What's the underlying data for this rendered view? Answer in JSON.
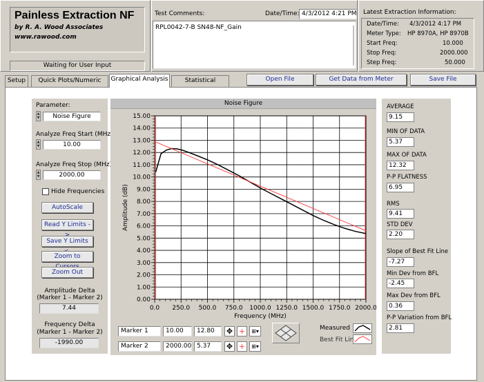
{
  "app": {
    "title": "Painless Extraction NF",
    "byline": "by R. A. Wood Associates",
    "url": "www.rawood.com",
    "status": "Waiting for User Input"
  },
  "test_comments": {
    "label": "Test Comments:",
    "date_time_label": "Date/Time:",
    "date_time_value": "4/3/2012  4:21 PM",
    "text": "RPL0042-7-B SN48-NF_Gain"
  },
  "latest": {
    "title": "Latest Extraction Information:",
    "rows": [
      {
        "label": "Date/Time:",
        "value": "4/3/2012  4:17 PM"
      },
      {
        "label": "Meter Type:",
        "value": "HP 8970A, HP 8970B"
      },
      {
        "label": "Start Freq:",
        "value": "10.000"
      },
      {
        "label": "Stop Freq:",
        "value": "2000.000"
      },
      {
        "label": "Step Freq:",
        "value": "50.000"
      }
    ]
  },
  "tabs": [
    "Setup",
    "Quick Plots/Numeric Data",
    "Graphical Analysis",
    "Statistical Analysis"
  ],
  "toolbar": {
    "open": "Open File",
    "get_data": "Get Data from Meter",
    "save": "Save File"
  },
  "left": {
    "parameter_label": "Parameter:",
    "parameter_value": "Noise Figure",
    "start_label": "Analyze Freq Start (MHz)",
    "start_value": "10.00",
    "stop_label": "Analyze Freq Stop (MHz)",
    "stop_value": "2000.00",
    "hide_label": "Hide Frequencies",
    "autoscale": "AutoScale",
    "read_y": "Read Y Limits ->",
    "save_y": "Save Y Limits <-",
    "zoom_cursors": "Zoom to Cursors",
    "zoom_out": "Zoom Out",
    "amp_delta_label1": "Amplitude Delta",
    "amp_delta_label2": "(Marker 1 - Marker 2)",
    "amp_delta_value": "7.44",
    "freq_delta_label1": "Frequency Delta",
    "freq_delta_label2": "(Marker 1 - Marker 2)",
    "freq_delta_value": "-1990.00"
  },
  "markers": [
    {
      "name": "Marker 1",
      "x": "10.00",
      "y": "12.80"
    },
    {
      "name": "Marker 2",
      "x": "2000.00",
      "y": "5.37"
    }
  ],
  "legend": {
    "measured": "Measured",
    "bestfit": "Best Fit Line"
  },
  "stats": [
    {
      "label": "AVERAGE",
      "value": "9.15"
    },
    {
      "label": "MIN OF DATA",
      "value": "5.37"
    },
    {
      "label": "MAX OF DATA",
      "value": "12.32"
    },
    {
      "label": "P-P FLATNESS",
      "value": "6.95"
    },
    {
      "label": "RMS",
      "value": "9.41"
    },
    {
      "label": "STD DEV",
      "value": "2.20"
    },
    {
      "label": "Slope of Best Fit Line",
      "value": "-7.27"
    },
    {
      "label": "Min Dev from BFL",
      "value": "-2.45"
    },
    {
      "label": "Max Dev from BFL",
      "value": "0.36"
    },
    {
      "label": "P-P Variation from BFL",
      "value": "2.81"
    }
  ],
  "colors": {
    "measured": "#000000",
    "bestfit": "#ff3030",
    "cursor": "#ff4040",
    "button_text": "#1e2d96"
  },
  "chart_data": {
    "type": "line",
    "title": "Noise Figure",
    "xlabel": "Frequency (MHz)",
    "ylabel": "Amplitude (dB)",
    "xlim": [
      0,
      2000
    ],
    "ylim": [
      0,
      15
    ],
    "xticks": [
      "0.0",
      "250.0",
      "500.0",
      "750.0",
      "1000.0",
      "1250.0",
      "1500.0",
      "1750.0",
      "2000.0"
    ],
    "yticks": [
      "0.00",
      "1.00",
      "2.00",
      "3.00",
      "4.00",
      "5.00",
      "6.00",
      "7.00",
      "8.00",
      "9.00",
      "10.00",
      "11.00",
      "12.00",
      "13.00",
      "14.00",
      "15.00"
    ],
    "grid": true,
    "series": [
      {
        "name": "Measured",
        "x": [
          10,
          60,
          110,
          160,
          210,
          260,
          310,
          400,
          500,
          600,
          700,
          800,
          900,
          1000,
          1100,
          1200,
          1300,
          1400,
          1500,
          1600,
          1700,
          1800,
          1900,
          2000
        ],
        "y": [
          10.4,
          11.9,
          12.2,
          12.32,
          12.3,
          12.2,
          12.05,
          11.75,
          11.4,
          11.0,
          10.55,
          10.1,
          9.6,
          9.1,
          8.65,
          8.2,
          7.75,
          7.3,
          6.85,
          6.45,
          6.1,
          5.8,
          5.55,
          5.37
        ]
      },
      {
        "name": "Best Fit Line",
        "x": [
          0,
          2000
        ],
        "y": [
          12.9,
          5.6
        ]
      }
    ],
    "cursors": [
      10,
      2000
    ]
  }
}
